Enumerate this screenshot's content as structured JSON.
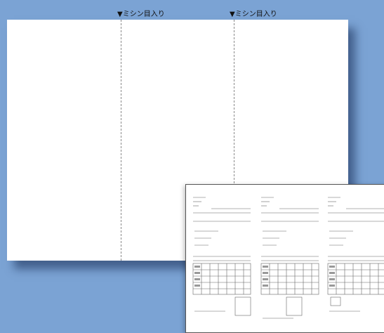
{
  "perforations": [
    {
      "label": "▼ミシン目入り"
    },
    {
      "label": "▼ミシン目入り"
    }
  ],
  "colors": {
    "background": "#7ba3d4",
    "sheet": "#ffffff",
    "perforation_line": "#8a8a8a"
  },
  "icons": {
    "perforation_marker": "down-triangle-icon"
  }
}
